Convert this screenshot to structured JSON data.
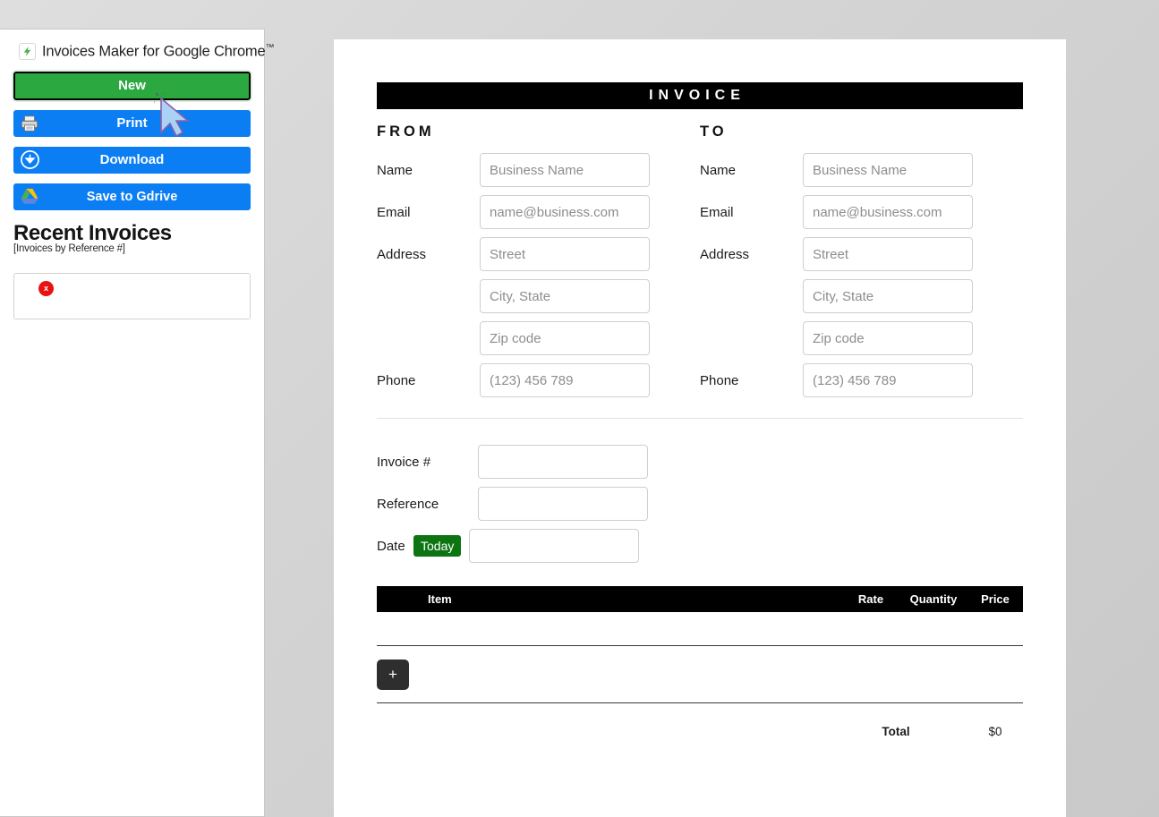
{
  "sidebar": {
    "brand": {
      "title": "Invoices Maker for Google Chrome",
      "tm": "™",
      "logo_icon": "lightning-bolt-icon"
    },
    "buttons": [
      {
        "label": "New",
        "icon": "",
        "color": "#2ba83f"
      },
      {
        "label": "Print",
        "icon": "printer-icon",
        "color": "#0b7ef4"
      },
      {
        "label": "Download",
        "icon": "download-circle-icon",
        "color": "#0b7ef4"
      },
      {
        "label": "Save to Gdrive",
        "icon": "google-drive-icon",
        "color": "#0b7ef4"
      }
    ],
    "recent": {
      "title": "Recent Invoices",
      "subtitle": "[Invoices by Reference #]",
      "delete_label": "x"
    }
  },
  "invoice": {
    "header_title": "INVOICE",
    "from": {
      "heading": "FROM",
      "fields": [
        {
          "label": "Name",
          "placeholder": "Business Name",
          "value": ""
        },
        {
          "label": "Email",
          "placeholder": "name@business.com",
          "value": ""
        },
        {
          "label": "Address",
          "placeholder": "Street",
          "value": ""
        },
        {
          "label": "",
          "placeholder": "City, State",
          "value": ""
        },
        {
          "label": "",
          "placeholder": "Zip code",
          "value": ""
        },
        {
          "label": "Phone",
          "placeholder": "(123) 456 789",
          "value": ""
        }
      ]
    },
    "to": {
      "heading": "TO",
      "fields": [
        {
          "label": "Name",
          "placeholder": "Business Name",
          "value": ""
        },
        {
          "label": "Email",
          "placeholder": "name@business.com",
          "value": ""
        },
        {
          "label": "Address",
          "placeholder": "Street",
          "value": ""
        },
        {
          "label": "",
          "placeholder": "City, State",
          "value": ""
        },
        {
          "label": "",
          "placeholder": "Zip code",
          "value": ""
        },
        {
          "label": "Phone",
          "placeholder": "(123) 456 789",
          "value": ""
        }
      ]
    },
    "meta": {
      "invoice_number_label": "Invoice #",
      "invoice_number_value": "",
      "reference_label": "Reference",
      "reference_value": "",
      "date_label": "Date",
      "today_button": "Today",
      "date_value": ""
    },
    "items_table": {
      "columns": [
        "Item",
        "Rate",
        "Quantity",
        "Price"
      ],
      "rows": []
    },
    "add_row_button": "+",
    "total_label": "Total",
    "total_value": "$0"
  },
  "colors": {
    "accent_green": "#2ba83f",
    "accent_blue": "#0b7ef4",
    "today_green": "#0c7512",
    "delete_red": "#e81212",
    "bar_black": "#000000"
  }
}
